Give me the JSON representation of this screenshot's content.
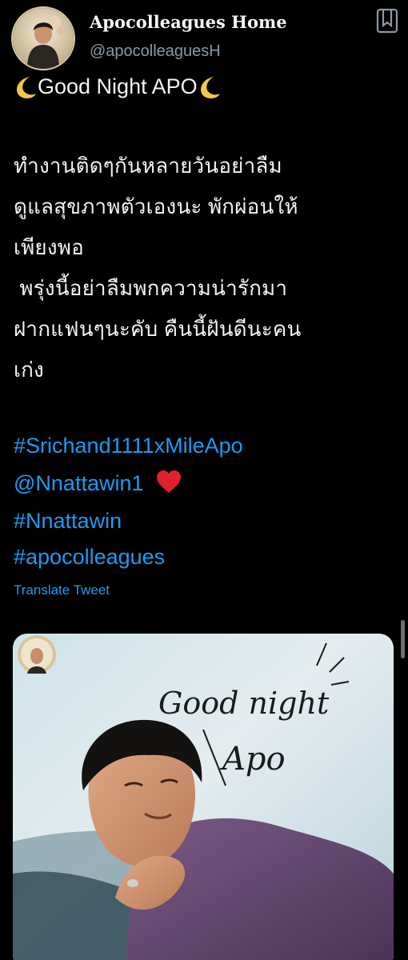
{
  "tweet": {
    "author": {
      "display_name": "Apocolleagues Home",
      "handle": "@apocolleaguesH",
      "avatar_caption": "APO Home"
    },
    "title_line": "Good Night APO",
    "body_lines": [
      "ทำงานติดๆกันหลายวันอย่าลืม",
      "ดูแลสุขภาพตัวเองนะ พักผ่อนให้",
      "เพียงพอ",
      " พรุ่งนี้อย่าลืมพกความน่ารักมา",
      "ฝากแฟนๆนะคับ คืนนี้ฝันดีนะคน",
      "เก่ง"
    ],
    "hashtag_1": "#Srichand1111xMileApo",
    "mention": "@Nnattawin1",
    "hashtag_2": "#Nnattawin",
    "hashtag_3": "#apocolleagues",
    "translate_label": "Translate Tweet"
  },
  "media": {
    "script_line_1": "Good night",
    "script_line_2": "Apo"
  },
  "icons": {
    "more": "more-options-icon",
    "moon": "crescent-moon-icon",
    "heart": "red-heart-icon"
  },
  "colors": {
    "background": "#000000",
    "link": "#1d9bf0",
    "text": "#e7e9ea",
    "handle": "#8b98a5",
    "heart": "#e0202e",
    "moon": "#f2c744"
  }
}
